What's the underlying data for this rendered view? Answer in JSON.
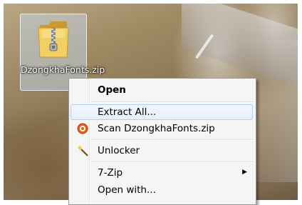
{
  "desktop_icon": {
    "label": "DzongkhaFonts.zip",
    "icon": "zip-folder-icon"
  },
  "context_menu": {
    "items": [
      {
        "label": "Open",
        "bold": true
      },
      {
        "label": "Extract All...",
        "highlighted": true
      },
      {
        "label": "Scan DzongkhaFonts.zip",
        "icon": "antivirus-scan-icon"
      },
      {
        "label": "Unlocker",
        "icon": "wand-icon"
      },
      {
        "label": "7-Zip",
        "submenu": true
      },
      {
        "label": "Open with..."
      }
    ]
  }
}
